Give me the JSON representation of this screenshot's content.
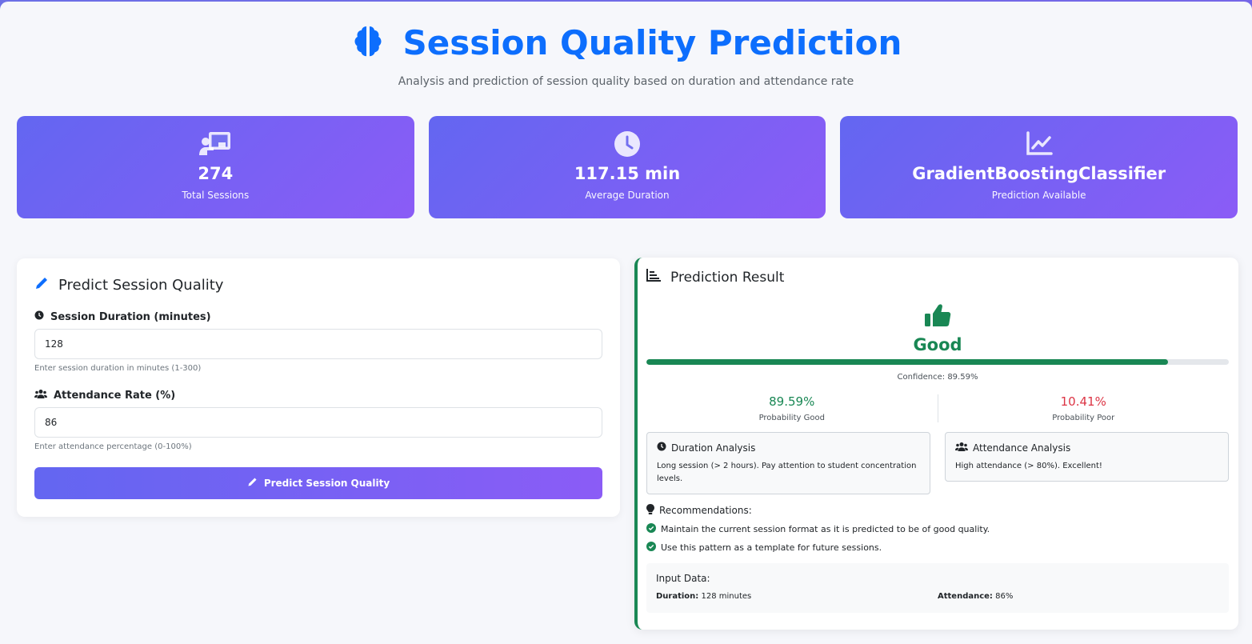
{
  "header": {
    "title": "Session Quality Prediction",
    "subtitle": "Analysis and prediction of session quality based on duration and attendance rate",
    "icon": "brain-icon"
  },
  "stats": [
    {
      "icon": "chalkboard-teacher-icon",
      "value": "274",
      "label": "Total Sessions"
    },
    {
      "icon": "clock-icon",
      "value": "117.15 min",
      "label": "Average Duration"
    },
    {
      "icon": "chart-line-icon",
      "value": "GradientBoostingClassifier",
      "label": "Prediction Available"
    }
  ],
  "form": {
    "title": "Predict Session Quality",
    "duration_label": "Session Duration (minutes)",
    "duration_value": "128",
    "duration_hint": "Enter session duration in minutes (1-300)",
    "attendance_label": "Attendance Rate (%)",
    "attendance_value": "86",
    "attendance_hint": "Enter attendance percentage (0-100%)",
    "button_label": "Predict Session Quality"
  },
  "result": {
    "title": "Prediction Result",
    "verdict": "Good",
    "confidence_fraction": 0.8959,
    "confidence_text": "Confidence: 89.59%",
    "prob_good_value": "89.59%",
    "prob_good_label": "Probability Good",
    "prob_poor_value": "10.41%",
    "prob_poor_label": "Probability Poor",
    "duration_analysis_title": "Duration Analysis",
    "duration_analysis_text": "Long session (> 2 hours). Pay attention to student concentration levels.",
    "attendance_analysis_title": "Attendance Analysis",
    "attendance_analysis_text": "High attendance (> 80%). Excellent!",
    "recommendations_title": "Recommendations:",
    "recommendations": [
      "Maintain the current session format as it is predicted to be of good quality.",
      "Use this pattern as a template for future sessions."
    ],
    "input_data_title": "Input Data:",
    "input_duration_key": "Duration:",
    "input_duration_val": "128 minutes",
    "input_attendance_key": "Attendance:",
    "input_attendance_val": "86%"
  },
  "colors": {
    "primary": "#0d6efd",
    "good": "#198754",
    "poor": "#dc3545",
    "gradient_start": "#6366f1",
    "gradient_end": "#8b5cf6"
  }
}
